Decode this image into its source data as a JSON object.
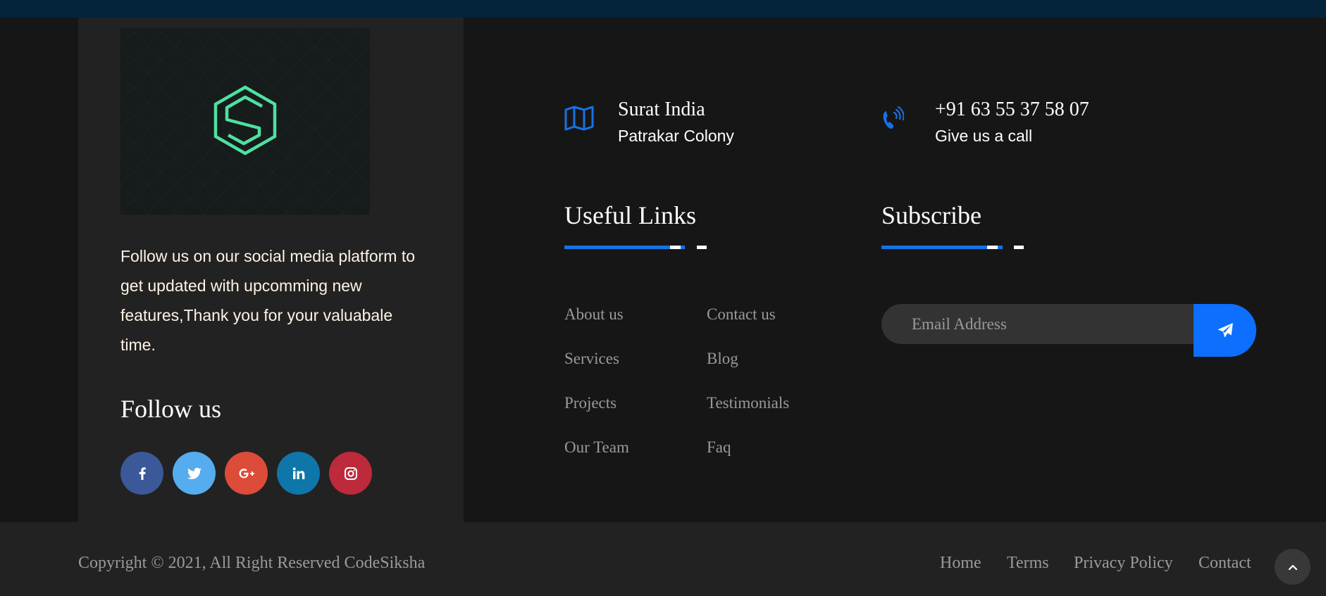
{
  "brand": {
    "logo_icon": "hexagon-s-logo-icon",
    "logo_color": "#4fe0a0"
  },
  "about": {
    "text": "Follow us on our social media platform to get updated with upcomming new features,Thank you for your valuabale time.",
    "follow_title": "Follow us"
  },
  "socials": [
    {
      "name": "facebook",
      "icon": "facebook-icon",
      "color": "#3b5998"
    },
    {
      "name": "twitter",
      "icon": "twitter-icon",
      "color": "#55acee"
    },
    {
      "name": "google-plus",
      "icon": "google-plus-icon",
      "color": "#dd4b39"
    },
    {
      "name": "linkedin",
      "icon": "linkedin-icon",
      "color": "#0e76a8"
    },
    {
      "name": "instagram",
      "icon": "instagram-icon",
      "color": "#bc2a3b"
    }
  ],
  "contact": {
    "address": {
      "icon": "map-icon",
      "title": "Surat India",
      "subtitle": "Patrakar Colony"
    },
    "phone": {
      "icon": "phone-ring-icon",
      "title": "+91 63 55 37 58 07",
      "subtitle": "Give us a call"
    }
  },
  "useful_links": {
    "title": "Useful Links",
    "items": [
      "About us",
      "Contact us",
      "Services",
      "Blog",
      "Projects",
      "Testimonials",
      "Our Team",
      "Faq"
    ]
  },
  "subscribe": {
    "title": "Subscribe",
    "placeholder": "Email Address",
    "button_icon": "paper-plane-icon"
  },
  "footer": {
    "copyright": "Copyright © 2021, All Right Reserved CodeSiksha",
    "nav": [
      "Home",
      "Terms",
      "Privacy Policy",
      "Contact"
    ],
    "scroll_top_icon": "chevron-up-icon"
  },
  "colors": {
    "accent": "#1673e6",
    "button": "#0d6ffe",
    "top_strip": "#04243c",
    "background": "#171617",
    "card": "#222222"
  }
}
